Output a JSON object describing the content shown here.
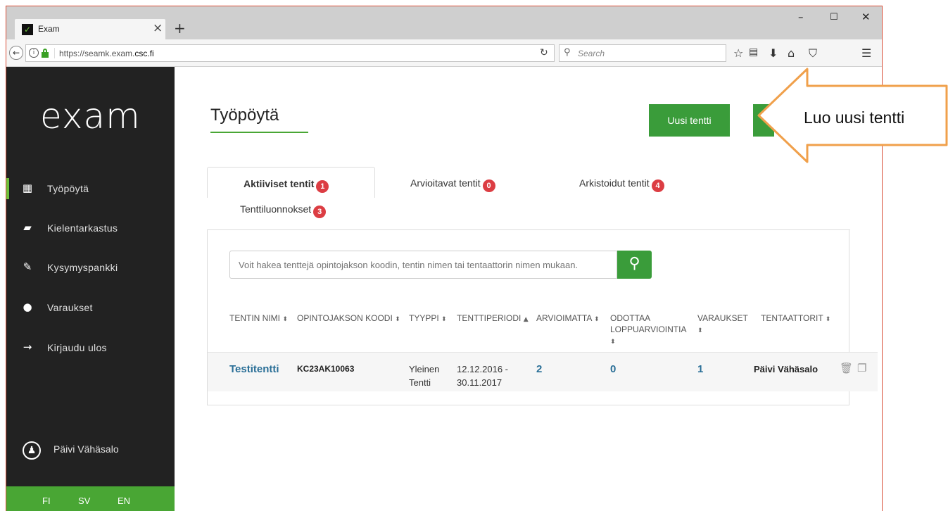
{
  "browser": {
    "tab_title": "Exam",
    "favicon": "exam-logo",
    "url_prefix": "https://seamk.exam.",
    "url_domain": "csc.fi",
    "search_placeholder": "Search"
  },
  "sidebar": {
    "logo": "exam",
    "items": [
      {
        "label": "Työpöytä",
        "icon": "dashboard-icon",
        "active": true
      },
      {
        "label": "Kielentarkastus",
        "icon": "book-icon",
        "active": false
      },
      {
        "label": "Kysymyspankki",
        "icon": "pencil-icon",
        "active": false
      },
      {
        "label": "Varaukset",
        "icon": "user-icon",
        "active": false
      },
      {
        "label": "Kirjaudu ulos",
        "icon": "arrow-right-icon",
        "active": false
      }
    ],
    "user_name": "Päivi Vähäsalo",
    "languages": [
      "FI",
      "SV",
      "EN"
    ]
  },
  "main": {
    "page_title": "Työpöytä",
    "new_exam_button": "Uusi tentti",
    "tabs": [
      {
        "label": "Aktiiviset tentit",
        "count": "1",
        "active": true
      },
      {
        "label": "Arvioitavat tentit",
        "count": "0",
        "active": false
      },
      {
        "label": "Arkistoidut tentit",
        "count": "4",
        "active": false
      },
      {
        "label": "Tenttiluonnokset",
        "count": "3",
        "active": false
      }
    ],
    "search_placeholder": "Voit hakea tenttejä opintojakson koodin, tentin nimen tai tentaattorin nimen mukaan.",
    "columns": [
      "TENTIN NIMI",
      "OPINTOJAKSON KOODI",
      "TYYPPI",
      "TENTTIPERIODI",
      "ARVIOIMATTA",
      "ODOTTAA LOPPUARVIOINTIA",
      "VARAUKSET",
      "TENTAATTORIT"
    ],
    "rows": [
      {
        "name": "Testitentti",
        "code": "KC23AK10063",
        "type": "Yleinen Tentti",
        "period": "12.12.2016 - 30.11.2017",
        "unrated": "2",
        "awaiting": "0",
        "reservations": "1",
        "examiners": "Päivi Vähäsalo"
      }
    ]
  },
  "callout": {
    "text": "Luo uusi tentti",
    "color": "#f0a04b"
  }
}
